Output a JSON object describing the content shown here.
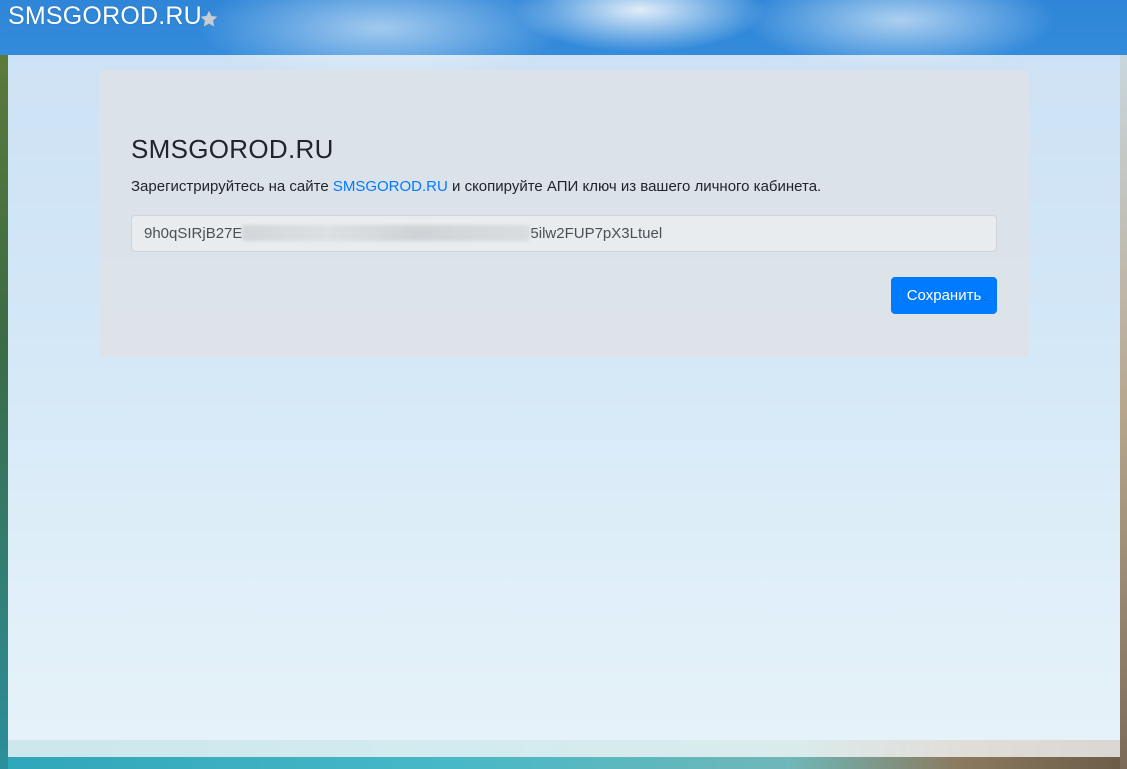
{
  "header": {
    "brand": "SMSGOROD.RU",
    "favorite_icon": "star-icon"
  },
  "panel": {
    "title": "SMSGOROD.RU",
    "description_before": "Зарегистрируйтесь на сайте ",
    "description_link": "SMSGOROD.RU",
    "description_after": " и скопируйте АПИ ключ из вашего личного кабинета.",
    "api_key_prefix": "9h0qSIRjB27E",
    "api_key_suffix": "5ilw2FUP7pX3Ltuel",
    "save_label": "Сохранить"
  },
  "colors": {
    "accent": "#007bff",
    "panel_bg": "#dee2e6",
    "text": "#212529"
  }
}
